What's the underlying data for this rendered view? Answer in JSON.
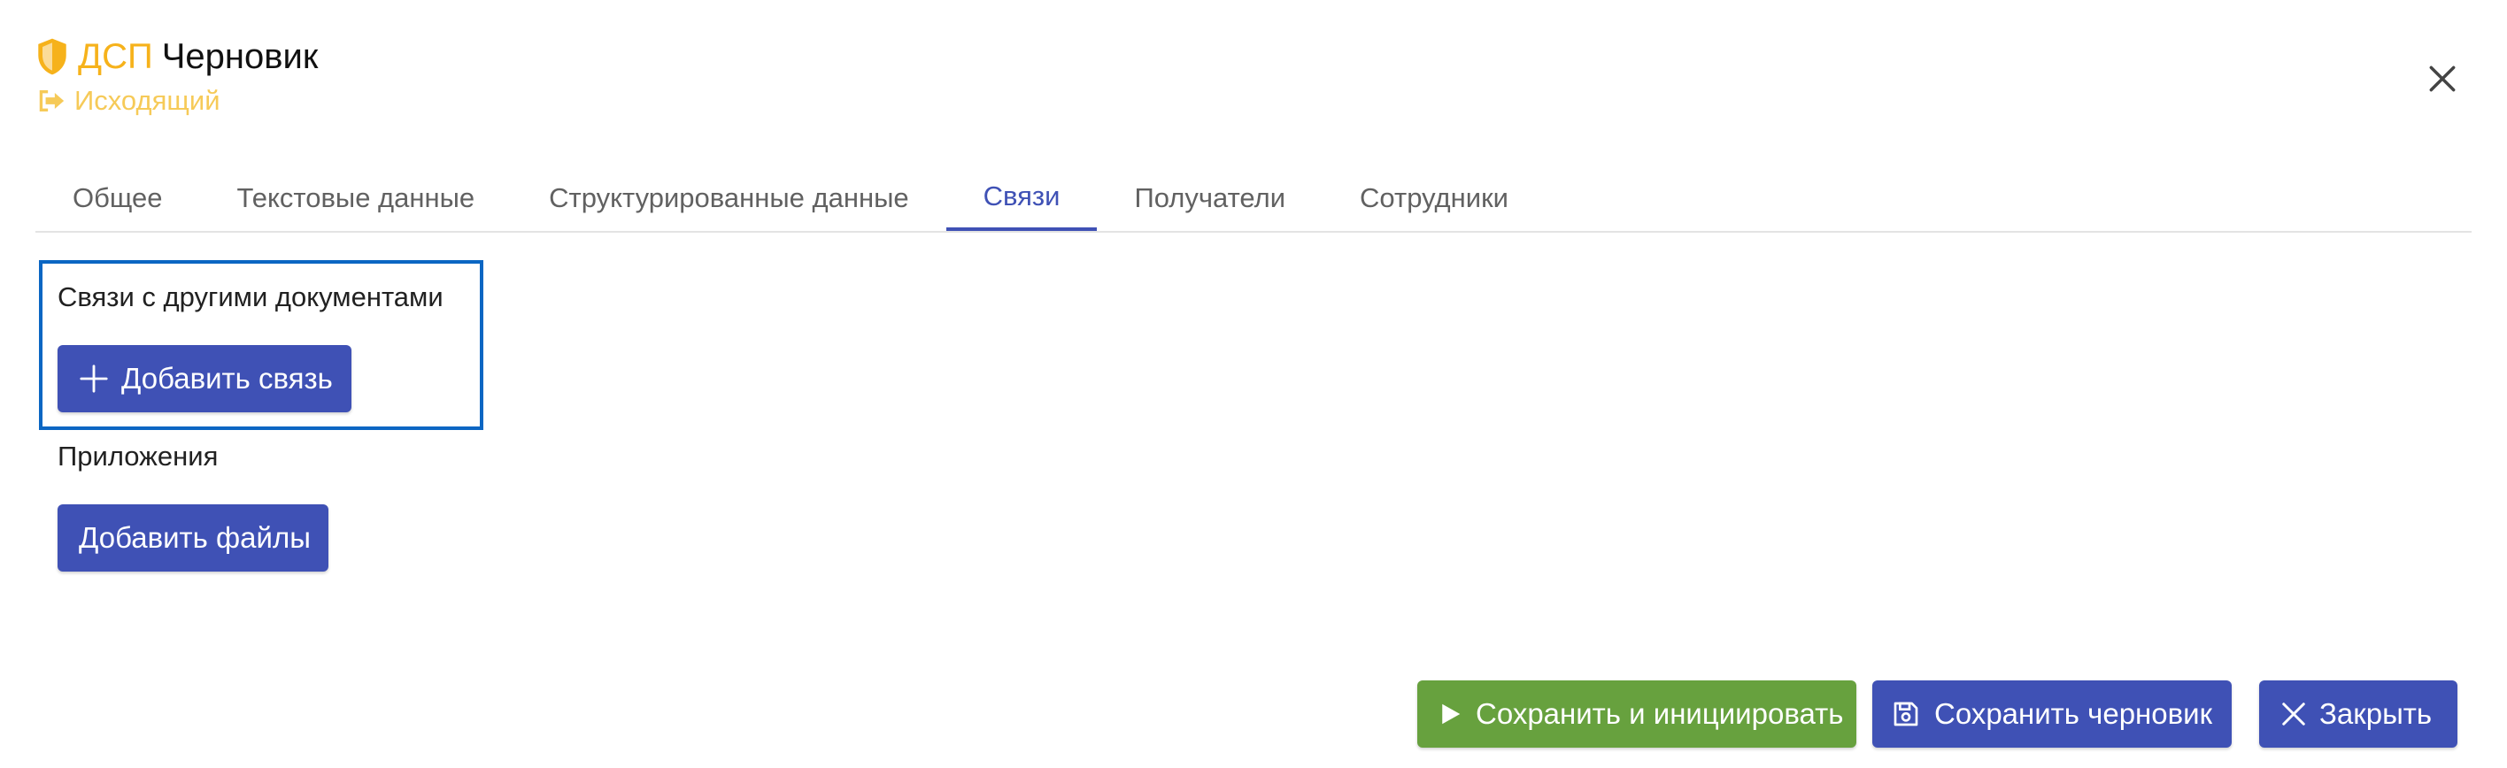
{
  "header": {
    "classification": "ДСП",
    "state": "Черновик",
    "direction": "Исходящий"
  },
  "tabs": [
    {
      "label": "Общее",
      "active": false
    },
    {
      "label": "Текстовые данные",
      "active": false
    },
    {
      "label": "Структурированные данные",
      "active": false
    },
    {
      "label": "Связи",
      "active": true
    },
    {
      "label": "Получатели",
      "active": false
    },
    {
      "label": "Сотрудники",
      "active": false
    }
  ],
  "links_section": {
    "title": "Связи с другими документами",
    "add_button": "Добавить связь"
  },
  "attachments_section": {
    "title": "Приложения",
    "add_button": "Добавить файлы"
  },
  "footer": {
    "save_initiate": "Сохранить и инициировать",
    "save_draft": "Сохранить черновик",
    "close": "Закрыть"
  },
  "colors": {
    "primary": "#3f51b5",
    "success": "#67a13e",
    "classification": "#f6b21b",
    "direction": "#f6ca58",
    "focus_border": "#0b66c3"
  },
  "icons": {
    "classification": "shield-icon",
    "direction": "sign-out-icon",
    "close": "close-icon",
    "add": "plus-icon",
    "initiate": "play-icon",
    "save": "floppy-disk-icon"
  }
}
